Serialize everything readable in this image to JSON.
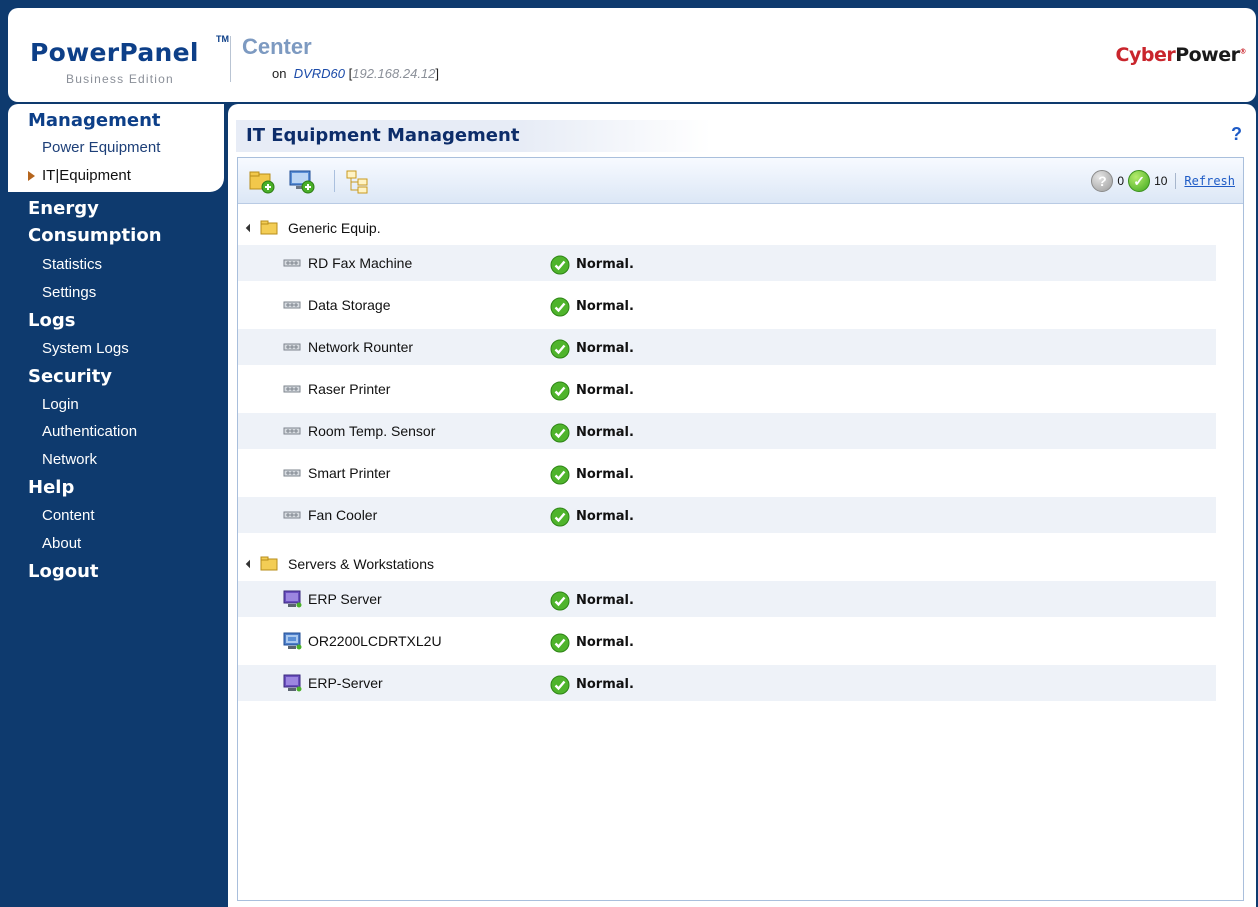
{
  "header": {
    "logo_main": "PowerPanel",
    "logo_tm": "TM",
    "logo_sub": "Business Edition",
    "center_title": "Center",
    "on_label": "on",
    "server_name": "DVRD60",
    "server_ip_open": "[",
    "server_ip": "192.168.24.12",
    "server_ip_close": "]",
    "brand_cyber": "Cyber",
    "brand_power": "Power",
    "brand_mark": "®"
  },
  "sidebar": {
    "management": "Management",
    "power_equipment": "Power Equipment",
    "it_equipment": "IT|Equipment",
    "energy": "Energy",
    "consumption": "Consumption",
    "statistics": "Statistics",
    "settings": "Settings",
    "logs": "Logs",
    "system_logs": "System Logs",
    "security": "Security",
    "login": "Login",
    "authentication": "Authentication",
    "network": "Network",
    "help": "Help",
    "content": "Content",
    "about": "About",
    "logout": "Logout"
  },
  "main": {
    "title": "IT Equipment Management",
    "help_label": "?",
    "status": {
      "unknown_count": "0",
      "ok_count": "10",
      "refresh_label": "Refresh"
    },
    "groups": [
      {
        "label": "Generic Equip.",
        "items": [
          {
            "name": "RD Fax Machine",
            "status": "Normal."
          },
          {
            "name": "Data Storage",
            "status": "Normal."
          },
          {
            "name": "Network Rounter",
            "status": "Normal."
          },
          {
            "name": "Raser Printer",
            "status": "Normal."
          },
          {
            "name": "Room Temp. Sensor",
            "status": "Normal."
          },
          {
            "name": "Smart Printer",
            "status": "Normal."
          },
          {
            "name": "Fan Cooler",
            "status": "Normal."
          }
        ]
      },
      {
        "label": "Servers & Workstations",
        "items": [
          {
            "name": "ERP Server",
            "status": "Normal."
          },
          {
            "name": "OR2200LCDRTXL2U",
            "status": "Normal."
          },
          {
            "name": "ERP-Server",
            "status": "Normal."
          }
        ]
      }
    ]
  },
  "colors": {
    "navy": "#0e3a6e",
    "brand_blue": "#0d3f88",
    "link_blue": "#1e5bc6",
    "ok_green": "#3fa91f",
    "brand_red": "#c9252c"
  }
}
